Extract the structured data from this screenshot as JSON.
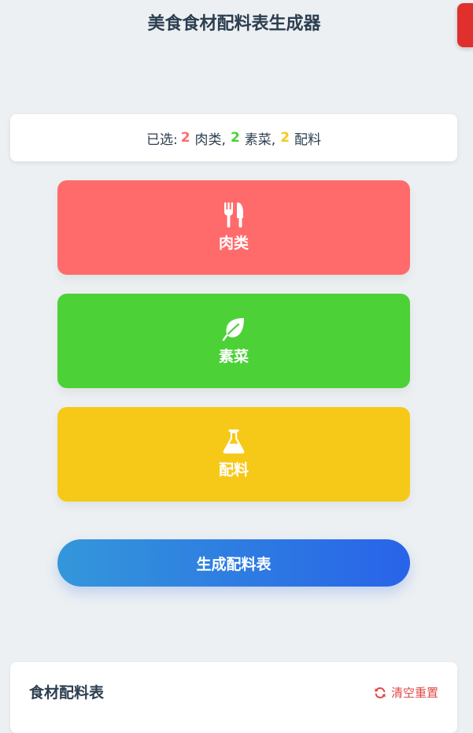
{
  "header": {
    "title": "美食食材配料表生成器"
  },
  "summary": {
    "prefix": "已选:",
    "meat_count": "2",
    "meat_label": "肉类,",
    "veg_count": "2",
    "veg_label": "素菜,",
    "spice_count": "2",
    "spice_label": "配料"
  },
  "categories": [
    {
      "label": "肉类",
      "icon": "utensils-icon",
      "color": "#ff6b6b"
    },
    {
      "label": "素菜",
      "icon": "leaf-icon",
      "color": "#4cd137"
    },
    {
      "label": "配料",
      "icon": "flask-icon",
      "color": "#f6c919"
    }
  ],
  "generate": {
    "label": "生成配料表",
    "gradient": [
      "#3497da",
      "#2863e9"
    ]
  },
  "list": {
    "title": "食材配料表",
    "reset_label": "清空重置",
    "reset_color": "#e04848"
  },
  "colors": {
    "background": "#ecf0f2",
    "text": "#2c3e50",
    "corner_tab": "#e0302e"
  }
}
